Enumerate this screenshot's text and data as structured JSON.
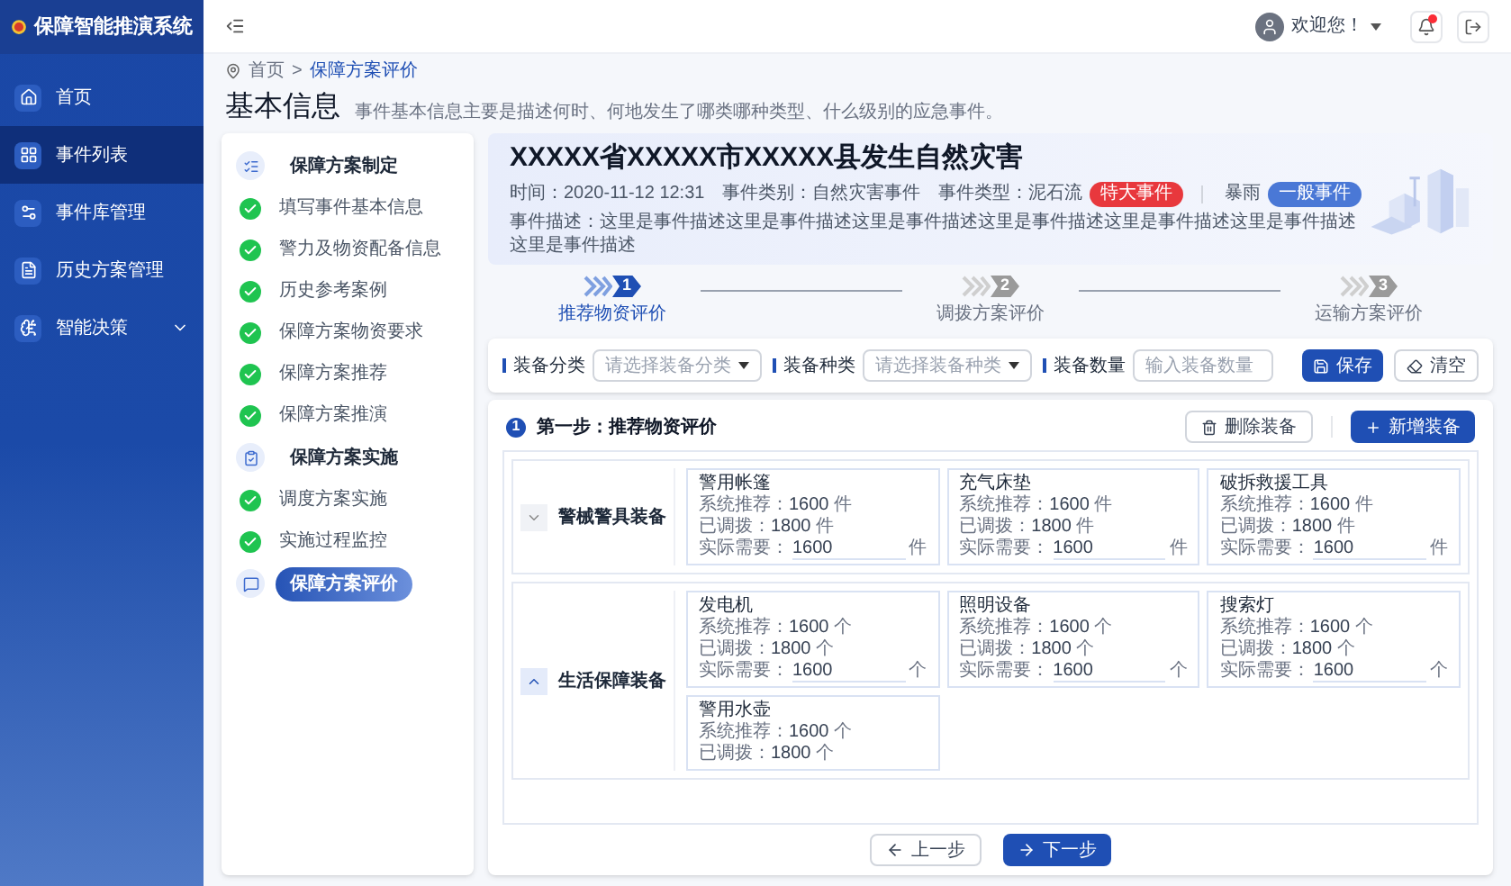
{
  "app": {
    "title": "保障智能推演系统"
  },
  "sidebar": {
    "items": [
      {
        "label": "首页",
        "kind": "link",
        "selected": false
      },
      {
        "label": "事件列表",
        "kind": "link",
        "selected": true
      },
      {
        "label": "事件库管理",
        "kind": "link",
        "selected": false
      },
      {
        "label": "历史方案管理",
        "kind": "link",
        "selected": false
      },
      {
        "label": "智能决策",
        "kind": "group",
        "selected": false
      }
    ]
  },
  "header": {
    "welcome": "欢迎您！",
    "unread_notifications": true
  },
  "breadcrumb": [
    {
      "label": "首页",
      "selected": false
    },
    {
      "label": "保障方案评价",
      "selected": true
    }
  ],
  "breadcrumb_separator": ">",
  "page": {
    "title": "基本信息",
    "subtitle": "事件基本信息主要是描述何时、何地发生了哪类哪种类型、什么级别的应急事件。"
  },
  "plan_steps": [
    {
      "title": "保障方案制定",
      "selected": false,
      "children": [
        {
          "label": "填写事件基本信息",
          "done": true
        },
        {
          "label": "警力及物资配备信息",
          "done": true
        },
        {
          "label": "历史参考案例",
          "done": true
        },
        {
          "label": "保障方案物资要求",
          "done": true
        },
        {
          "label": "保障方案推荐",
          "done": true
        },
        {
          "label": "保障方案推演",
          "done": true
        }
      ]
    },
    {
      "title": "保障方案实施",
      "selected": false,
      "children": [
        {
          "label": "调度方案实施",
          "done": true
        },
        {
          "label": "实施过程监控",
          "done": true
        }
      ]
    },
    {
      "title": "保障方案评价",
      "selected": true
    }
  ],
  "event": {
    "title": "XXXXX省XXXXX市XXXXX县发生自然灾害",
    "meta": [
      {
        "text": "时间：2020-11-12   12:31"
      },
      {
        "text": "事件类别：自然灾害事件"
      },
      {
        "text": "事件类型：泥石流",
        "tag": {
          "label": "特大事件",
          "color": "#e8383d"
        }
      },
      {
        "text": "暴雨",
        "tag": {
          "label": "一般事件",
          "color": "#4a78d6"
        }
      }
    ],
    "description": "事件描述：这里是事件描述这里是事件描述这里是事件描述这里是事件描述这里是事件描述这里是事件描述这里是事件描述"
  },
  "stepper": [
    {
      "number": "1",
      "label": "推荐物资评价",
      "selected": true
    },
    {
      "number": "2",
      "label": "调拨方案评价",
      "selected": false
    },
    {
      "number": "3",
      "label": "运输方案评价",
      "selected": false
    }
  ],
  "filters": [
    {
      "label": "装备分类",
      "kind": "select",
      "placeholder": "请选择装备分类"
    },
    {
      "label": "装备种类",
      "kind": "select",
      "placeholder": "请选择装备种类"
    },
    {
      "label": "装备数量",
      "kind": "input",
      "placeholder": "输入装备数量"
    }
  ],
  "filter_buttons": [
    {
      "label": "保存",
      "kind": "primary"
    },
    {
      "label": "清空",
      "kind": "default"
    }
  ],
  "section": {
    "badge": "1",
    "title": "第一步：推荐物资评价",
    "buttons": [
      {
        "label": "删除装备",
        "kind": "default"
      },
      {
        "label": "新增装备",
        "kind": "primary"
      }
    ]
  },
  "groups": [
    {
      "name": "警械警具装备",
      "expanded": false,
      "items": [
        {
          "name": "警用帐篷",
          "stats": [
            {
              "label": "系统推荐：",
              "value": "1600",
              "unit": "件"
            },
            {
              "label": "已调拨：",
              "value": "1800",
              "unit": "件"
            }
          ],
          "actual": {
            "label": "实际需要：",
            "value": "1600",
            "unit": "件"
          }
        },
        {
          "name": "充气床垫",
          "stats": [
            {
              "label": "系统推荐：",
              "value": "1600",
              "unit": "件"
            },
            {
              "label": "已调拨：",
              "value": "1800",
              "unit": "件"
            }
          ],
          "actual": {
            "label": "实际需要：",
            "value": "1600",
            "unit": "件"
          }
        },
        {
          "name": "破拆救援工具",
          "stats": [
            {
              "label": "系统推荐：",
              "value": "1600",
              "unit": "件"
            },
            {
              "label": "已调拨：",
              "value": "1800",
              "unit": "件"
            }
          ],
          "actual": {
            "label": "实际需要：",
            "value": "1600",
            "unit": "件"
          }
        }
      ]
    },
    {
      "name": "生活保障装备",
      "expanded": true,
      "items": [
        {
          "name": "发电机",
          "stats": [
            {
              "label": "系统推荐：",
              "value": "1600",
              "unit": "个"
            },
            {
              "label": "已调拨：",
              "value": "1800",
              "unit": "个"
            }
          ],
          "actual": {
            "label": "实际需要：",
            "value": "1600",
            "unit": "个"
          }
        },
        {
          "name": "照明设备",
          "stats": [
            {
              "label": "系统推荐：",
              "value": "1600",
              "unit": "个"
            },
            {
              "label": "已调拨：",
              "value": "1800",
              "unit": "个"
            }
          ],
          "actual": {
            "label": "实际需要：",
            "value": "1600",
            "unit": "个"
          }
        },
        {
          "name": "搜索灯",
          "stats": [
            {
              "label": "系统推荐：",
              "value": "1600",
              "unit": "个"
            },
            {
              "label": "已调拨：",
              "value": "1800",
              "unit": "个"
            }
          ],
          "actual": {
            "label": "实际需要：",
            "value": "1600",
            "unit": "个"
          }
        },
        {
          "name": "警用水壶",
          "stats": [
            {
              "label": "系统推荐：",
              "value": "1600",
              "unit": "个"
            },
            {
              "label": "已调拨：",
              "value": "1800",
              "unit": "个"
            }
          ]
        }
      ]
    }
  ],
  "footer_buttons": [
    {
      "label": "上一步",
      "kind": "prev"
    },
    {
      "label": "下一步",
      "kind": "next"
    }
  ]
}
